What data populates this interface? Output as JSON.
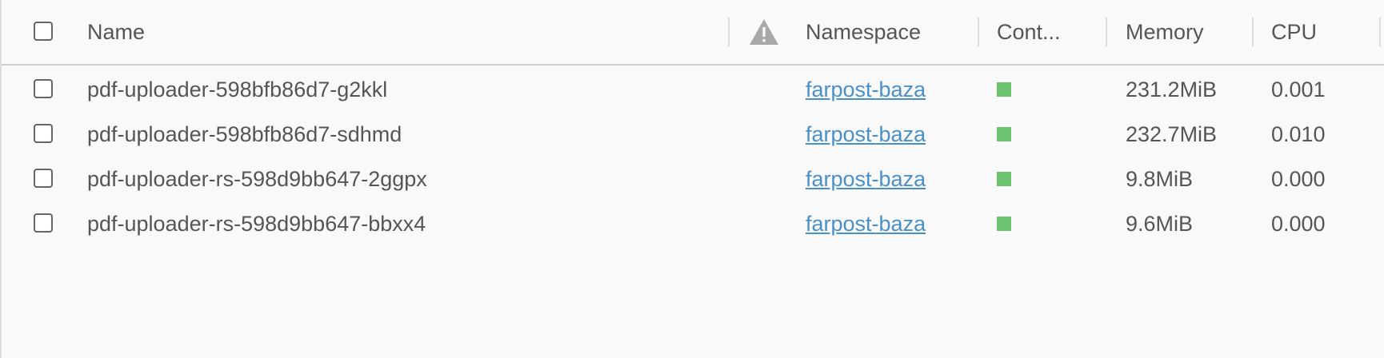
{
  "header": {
    "select_all_label": "",
    "columns": {
      "name": "Name",
      "warning": "warning-icon",
      "namespace": "Namespace",
      "containers": "Cont...",
      "memory": "Memory",
      "cpu": "CPU"
    }
  },
  "rows": [
    {
      "name": "pdf-uploader-598bfb86d7-g2kkl",
      "namespace": "farpost-baza",
      "container_status": "running",
      "memory": "231.2MiB",
      "cpu": "0.001"
    },
    {
      "name": "pdf-uploader-598bfb86d7-sdhmd",
      "namespace": "farpost-baza",
      "container_status": "running",
      "memory": "232.7MiB",
      "cpu": "0.010"
    },
    {
      "name": "pdf-uploader-rs-598d9bb647-2ggpx",
      "namespace": "farpost-baza",
      "container_status": "running",
      "memory": "9.8MiB",
      "cpu": "0.000"
    },
    {
      "name": "pdf-uploader-rs-598d9bb647-bbxx4",
      "namespace": "farpost-baza",
      "container_status": "running",
      "memory": "9.6MiB",
      "cpu": "0.000"
    }
  ],
  "colors": {
    "link": "#4a90c8",
    "status_ok": "#6cc36f",
    "text": "#555555",
    "warning_icon": "#a8a8a8"
  }
}
